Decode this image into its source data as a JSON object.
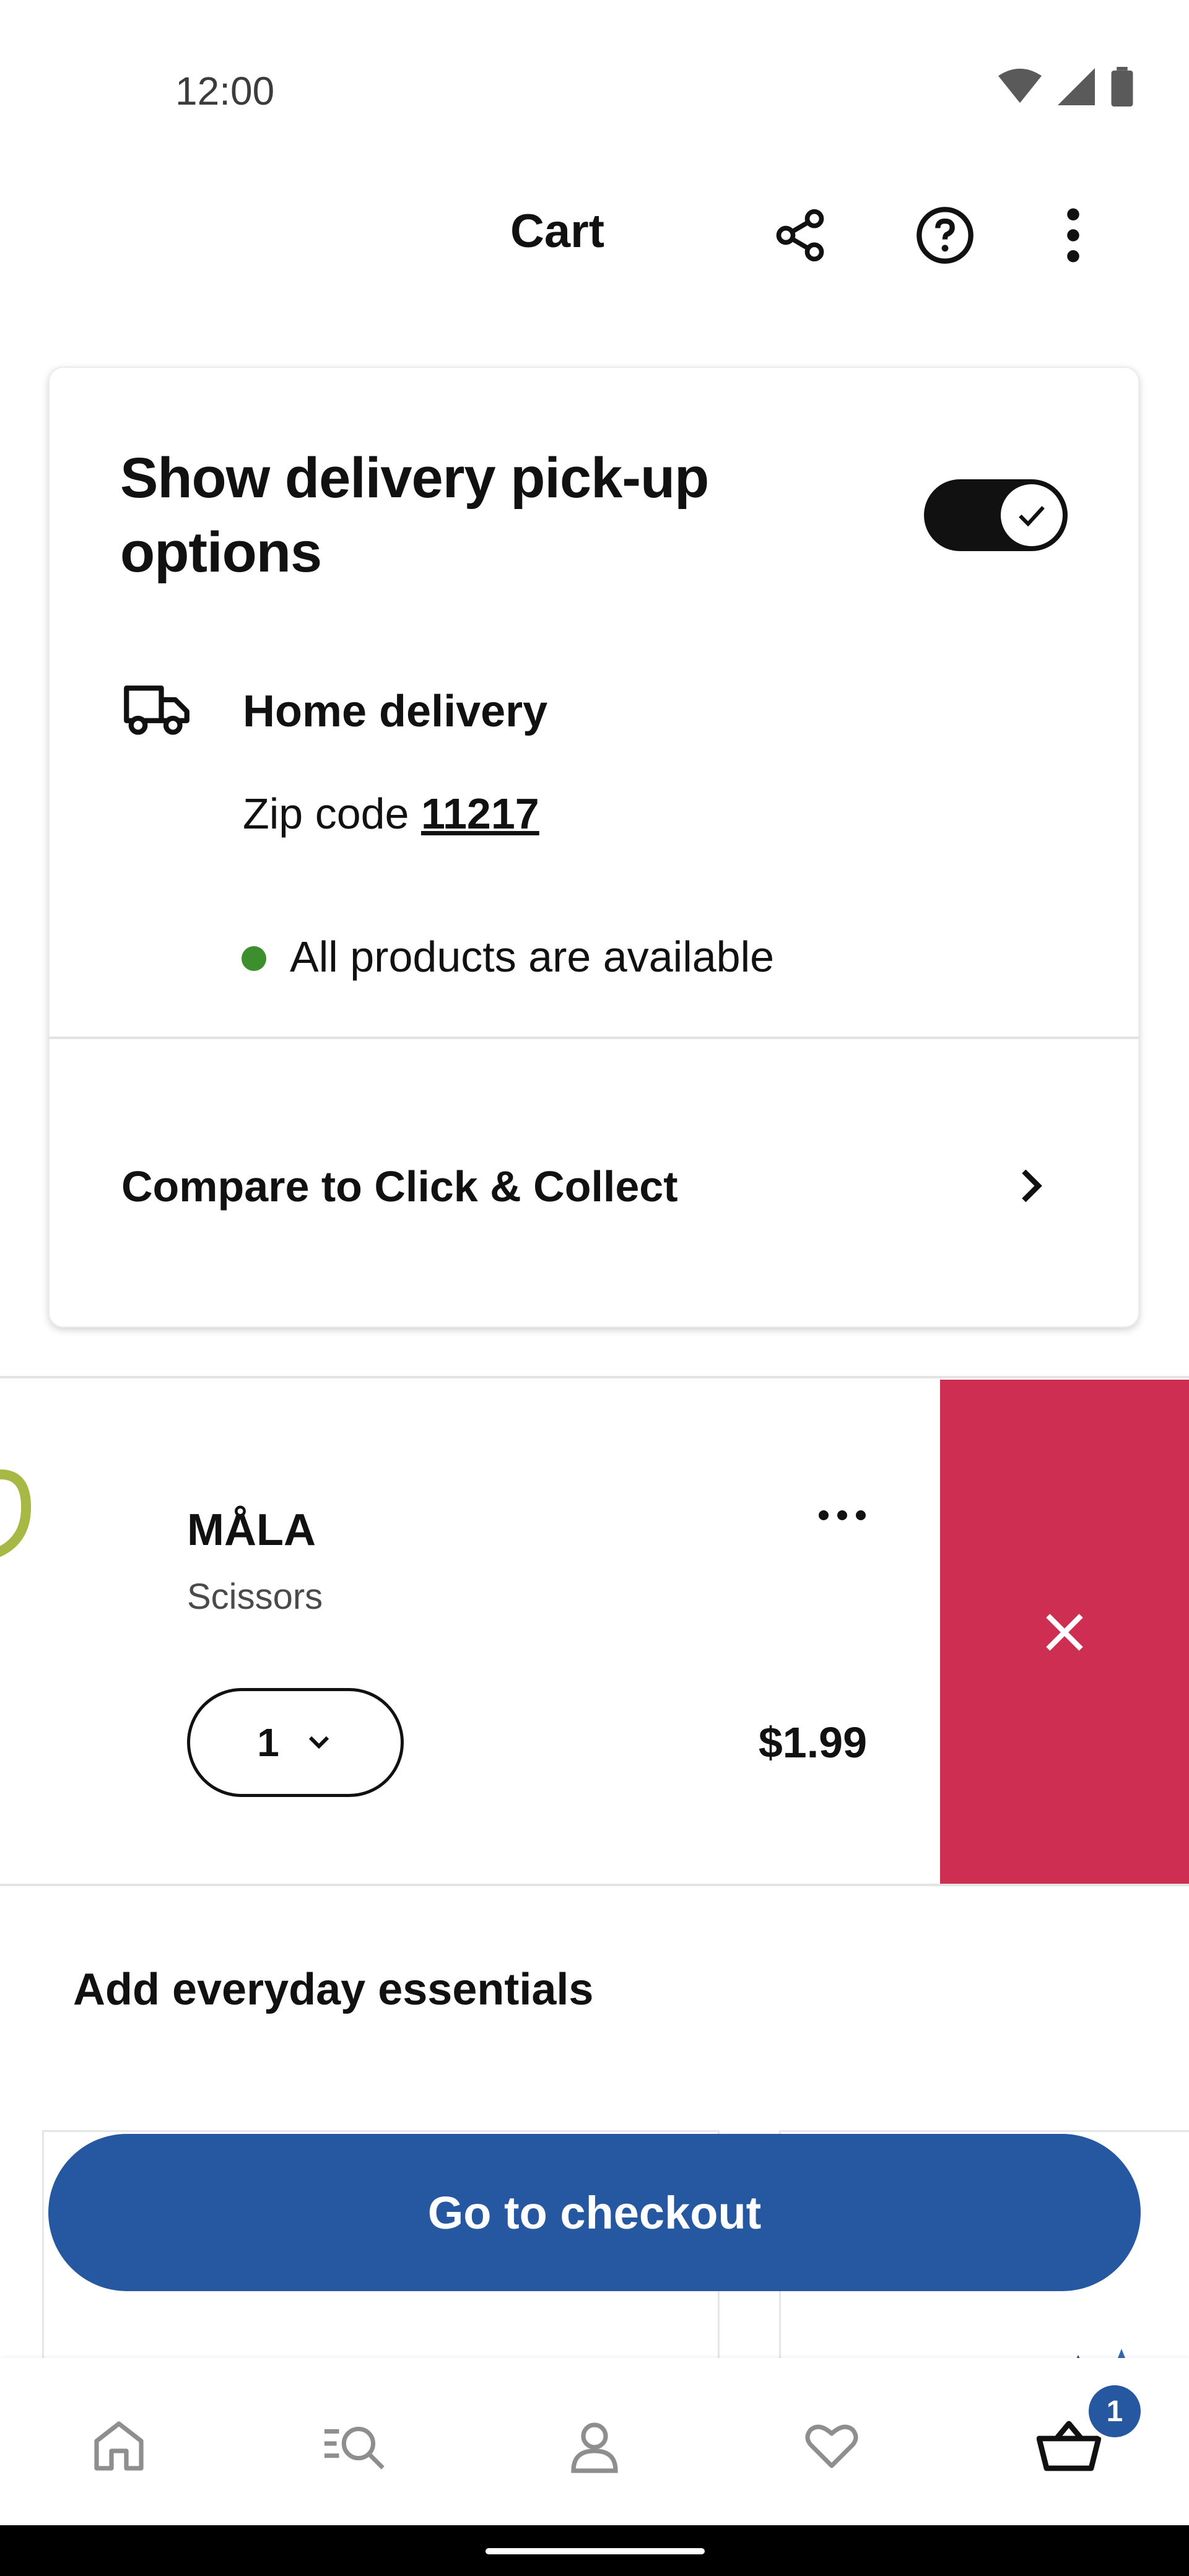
{
  "status_bar": {
    "time": "12:00"
  },
  "header": {
    "title": "Cart"
  },
  "delivery_card": {
    "title": "Show delivery pick-up options",
    "toggle_on": true,
    "home_delivery_label": "Home delivery",
    "zip_prefix": "Zip code",
    "zip_code": "11217",
    "availability_text": "All products are available",
    "availability_color": "#3c8f2c",
    "compare_label": "Compare to Click & Collect"
  },
  "cart_item": {
    "name": "MÅLA",
    "description": "Scissors",
    "quantity": "1",
    "price": "$1.99",
    "delete_color": "#cd2e52"
  },
  "essentials": {
    "heading": "Add everyday essentials"
  },
  "checkout": {
    "label": "Go to checkout",
    "color": "#2558a0"
  },
  "bottom_nav": {
    "items": [
      "home-icon",
      "search-icon",
      "profile-icon",
      "favorites-icon",
      "cart-icon"
    ],
    "cart_badge": "1"
  }
}
